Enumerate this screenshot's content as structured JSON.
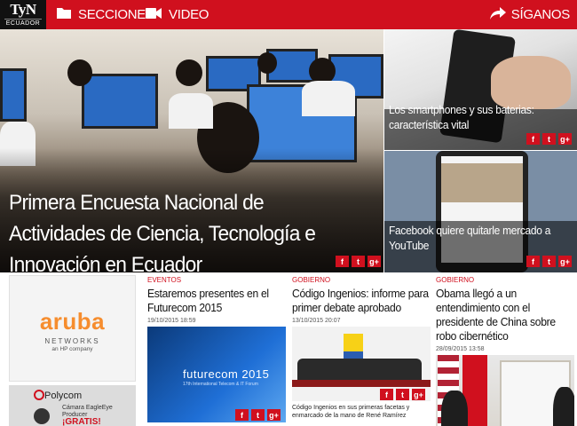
{
  "header": {
    "logo_mark": "TyN",
    "logo_sub": "ECUADOR",
    "sections_label": "SECCIONES",
    "video_label": "VIDEO",
    "follow_label": "SÍGANOS"
  },
  "share": {
    "facebook": "f",
    "twitter": "t",
    "gplus": "g+"
  },
  "hero": {
    "title": "Primera Encuesta Nacional de Actividades de Ciencia, Tecnología e Innovación en Ecuador"
  },
  "side_stories": [
    {
      "title": "Los smartphones y sus baterias: característica vital"
    },
    {
      "title": "Facebook quiere quitarle mercado a YouTube"
    }
  ],
  "ads": {
    "aruba": {
      "name": "aruba",
      "line1": "NETWORKS",
      "line2": "an HP company"
    },
    "polycom": {
      "name": "Polycom",
      "line1": "Cámara EagleEye",
      "line2": "Producer",
      "promo": "¡GRATIS!"
    }
  },
  "articles": [
    {
      "category": "EVENTOS",
      "title": "Estaremos presentes en el Futurecom 2015",
      "date": "19/10/2015 18:59",
      "image_text": "futurecom 2015",
      "image_subtext": "17th International Telecom & IT Forum",
      "excerpt": ""
    },
    {
      "category": "GOBIERNO",
      "title": "Código Ingenios: informe para primer debate aprobado",
      "date": "13/10/2015 20:07",
      "excerpt": "Código Ingenios en sus primeras facetas y enmarcado de la mano de René Ramírez"
    },
    {
      "category": "GOBIERNO",
      "title": "Obama llegó a un entendimiento con el presidente de China sobre robo cibernético",
      "date": "28/09/2015 13:58",
      "excerpt": ""
    }
  ],
  "colors": {
    "brand_red": "#d0101e",
    "aruba_orange": "#f68d2e"
  }
}
